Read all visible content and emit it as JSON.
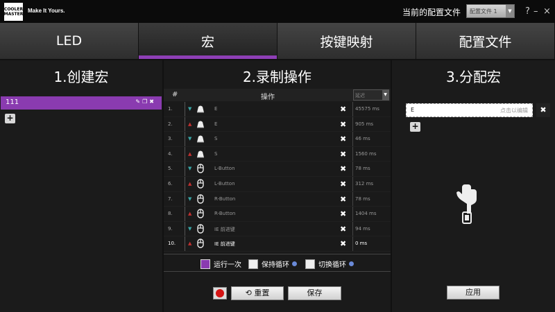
{
  "titlebar": {
    "logo_line1": "COOLER",
    "logo_line2": "MASTER",
    "tagline": "Make It Yours.",
    "profile_label": "当前的配置文件",
    "profile_value": "配置文件 1",
    "help": "?",
    "minimize": "–",
    "close": "×"
  },
  "tabs": [
    {
      "label": "LED",
      "active": false
    },
    {
      "label": "宏",
      "active": true
    },
    {
      "label": "按键映射",
      "active": false
    },
    {
      "label": "配置文件",
      "active": false
    }
  ],
  "create": {
    "title": "1.创建宏",
    "macro_name": "111",
    "add": "+"
  },
  "record": {
    "title": "2.录制操作",
    "col_num": "#",
    "col_op": "操作",
    "delay_select": "延迟",
    "rows": [
      {
        "num": "1.",
        "dir": "down",
        "icon": "key-icon",
        "name": "E",
        "delay": "45575 ms"
      },
      {
        "num": "2.",
        "dir": "up",
        "icon": "key-icon",
        "name": "E",
        "delay": "905   ms"
      },
      {
        "num": "3.",
        "dir": "down",
        "icon": "key-icon",
        "name": "S",
        "delay": "46    ms"
      },
      {
        "num": "4.",
        "dir": "up",
        "icon": "key-icon",
        "name": "S",
        "delay": "1560  ms"
      },
      {
        "num": "5.",
        "dir": "down",
        "icon": "mouse-icon",
        "name": "L-Button",
        "delay": "78    ms"
      },
      {
        "num": "6.",
        "dir": "up",
        "icon": "mouse-icon",
        "name": "L-Button",
        "delay": "312   ms"
      },
      {
        "num": "7.",
        "dir": "down",
        "icon": "mouse-icon",
        "name": "R-Button",
        "delay": "78    ms"
      },
      {
        "num": "8.",
        "dir": "up",
        "icon": "mouse-icon",
        "name": "R-Button",
        "delay": "1404  ms"
      },
      {
        "num": "9.",
        "dir": "down",
        "icon": "mouse-icon",
        "name": "IE 前进键",
        "delay": "94    ms"
      },
      {
        "num": "10.",
        "dir": "up",
        "icon": "mouse-icon",
        "name": "IE 前进键",
        "delay": "0     ms"
      }
    ],
    "modes": [
      {
        "label": "运行一次",
        "checked": true,
        "info": false
      },
      {
        "label": "保持循环",
        "checked": false,
        "info": true
      },
      {
        "label": "切换循环",
        "checked": false,
        "info": true
      }
    ],
    "reset_label": "重置",
    "save_label": "保存"
  },
  "assign": {
    "title": "3.分配宏",
    "key": "E",
    "hint": "点击以编辑",
    "apply_label": "应用"
  },
  "colors": {
    "accent": "#8a3bb0",
    "record": "#d41414",
    "arrow_down": "#3aa6a6",
    "arrow_up": "#c03030"
  }
}
